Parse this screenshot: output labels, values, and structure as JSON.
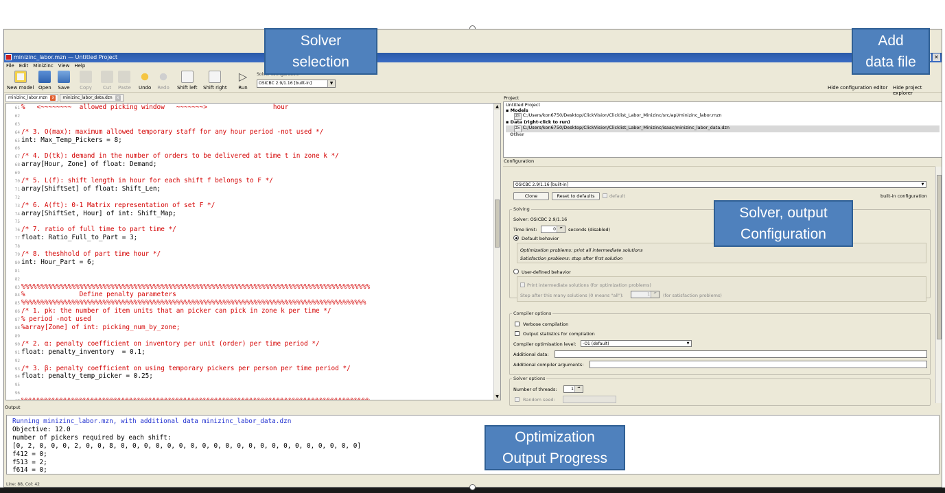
{
  "window": {
    "title": "minizinc_labor.mzn — Untitled Project",
    "controls": [
      "🗗",
      "✕"
    ]
  },
  "menu": [
    "File",
    "Edit",
    "MiniZinc",
    "View",
    "Help"
  ],
  "toolbar": {
    "buttons": [
      {
        "label": "New model",
        "icon": "new-model-icon",
        "enabled": true
      },
      {
        "label": "Open",
        "icon": "folder-open-icon",
        "enabled": true
      },
      {
        "label": "Save",
        "icon": "save-icon",
        "enabled": true
      },
      {
        "label": "Copy",
        "icon": "copy-icon",
        "enabled": false
      },
      {
        "label": "Cut",
        "icon": "scissors-icon",
        "enabled": false
      },
      {
        "label": "Paste",
        "icon": "paste-icon",
        "enabled": false
      },
      {
        "label": "Undo",
        "icon": "undo-icon",
        "enabled": true
      },
      {
        "label": "Redo",
        "icon": "redo-icon",
        "enabled": false
      },
      {
        "label": "Shift left",
        "icon": "shift-left-icon",
        "enabled": true
      },
      {
        "label": "Shift right",
        "icon": "shift-right-icon",
        "enabled": true
      },
      {
        "label": "Run",
        "icon": "play-icon",
        "enabled": true
      }
    ],
    "solver_label": "Solver configuration:",
    "solver_value": "OSICBC 2.9/1.16 [built-in]",
    "right_buttons": [
      {
        "label": "Hide configuration editor",
        "icon": "wrench-icon"
      },
      {
        "label": "Hide project explorer",
        "icon": "project-icon"
      }
    ]
  },
  "tabs": [
    {
      "label": "minizinc_labor.mzn",
      "active": true
    },
    {
      "label": "minizinc_labor_data.dzn",
      "active": false
    }
  ],
  "editor": {
    "lines": [
      {
        "n": "61",
        "text": "%   <~~~~~~~~  allowed picking window   ~~~~~~~>                 hour",
        "kind": "comment"
      },
      {
        "n": "62",
        "text": "",
        "kind": "plain"
      },
      {
        "n": "63",
        "text": "",
        "kind": "plain"
      },
      {
        "n": "64",
        "text": "/* 3. O(max): maximum allowed temporary staff for any hour period -not used */",
        "kind": "comment"
      },
      {
        "n": "65",
        "text": "int: Max_Temp_Pickers = 8;",
        "kind": "code"
      },
      {
        "n": "66",
        "text": "",
        "kind": "plain"
      },
      {
        "n": "67",
        "text": "/* 4. D(tk): demand in the number of orders to be delivered at time t in zone k */",
        "kind": "comment"
      },
      {
        "n": "68",
        "text": "array[Hour, Zone] of float: Demand;",
        "kind": "code"
      },
      {
        "n": "69",
        "text": "",
        "kind": "plain"
      },
      {
        "n": "70",
        "text": "/* 5. L(f): shift length in hour for each shift f belongs to F */",
        "kind": "comment"
      },
      {
        "n": "71",
        "text": "array[ShiftSet] of float: Shift_Len;",
        "kind": "code"
      },
      {
        "n": "72",
        "text": "",
        "kind": "plain"
      },
      {
        "n": "73",
        "text": "/* 6. A(ft): 0-1 Matrix representation of set F */",
        "kind": "comment"
      },
      {
        "n": "74",
        "text": "array[ShiftSet, Hour] of int: Shift_Map;",
        "kind": "code"
      },
      {
        "n": "75",
        "text": "",
        "kind": "plain"
      },
      {
        "n": "76",
        "text": "/* 7. ratio of full time to part time */",
        "kind": "comment"
      },
      {
        "n": "77",
        "text": "float: Ratio_Full_to_Part = 3;",
        "kind": "code"
      },
      {
        "n": "78",
        "text": "",
        "kind": "plain"
      },
      {
        "n": "79",
        "text": "/* 8. theshhold of part time hour */",
        "kind": "comment"
      },
      {
        "n": "80",
        "text": "int: Hour_Part = 6;",
        "kind": "code"
      },
      {
        "n": "81",
        "text": "",
        "kind": "plain"
      },
      {
        "n": "82",
        "text": "",
        "kind": "plain"
      },
      {
        "n": "83",
        "text": "%%%%%%%%%%%%%%%%%%%%%%%%%%%%%%%%%%%%%%%%%%%%%%%%%%%%%%%%%%%%%%%%%%%%%%%%%%%%%%%%%%%%%%%%%%",
        "kind": "comment"
      },
      {
        "n": "84",
        "text": "%              Define penalty parameters",
        "kind": "comment"
      },
      {
        "n": "85",
        "text": "%%%%%%%%%%%%%%%%%%%%%%%%%%%%%%%%%%%%%%%%%%%%%%%%%%%%%%%%%%%%%%%%%%%%%%%%%%%%%%%%%%%%%%%%%",
        "kind": "comment"
      },
      {
        "n": "86",
        "text": "/* 1. pk: the number of item units that an picker can pick in zone k per time */",
        "kind": "comment"
      },
      {
        "n": "87",
        "text": "% period -not used",
        "kind": "comment"
      },
      {
        "n": "88",
        "text": "%array[Zone] of int: picking_num_by_zone;",
        "kind": "comment"
      },
      {
        "n": "89",
        "text": "",
        "kind": "plain"
      },
      {
        "n": "90",
        "text": "/* 2. α: penalty coefficient on inventory per unit (order) per time period */",
        "kind": "comment"
      },
      {
        "n": "91",
        "text": "float: penalty_inventory  = 0.1;",
        "kind": "code"
      },
      {
        "n": "92",
        "text": "",
        "kind": "plain"
      },
      {
        "n": "93",
        "text": "/* 3. β: penalty coefficient on using temporary pickers per person per time period */",
        "kind": "comment"
      },
      {
        "n": "94",
        "text": "float: penalty_temp_picker = 0.25;",
        "kind": "code"
      },
      {
        "n": "95",
        "text": "",
        "kind": "plain"
      },
      {
        "n": "96",
        "text": "",
        "kind": "plain"
      },
      {
        "n": "97",
        "text": "%%%%%%%%%%%%%%%%%%%%%%%%%%%%%%%%%%%%%%%%%%%%%%%%%%%%%%%%%%%%%%%%%%%%%%%%%%%%%%%%%%%%%%%%%%",
        "kind": "comment"
      }
    ]
  },
  "project": {
    "title": "Project",
    "tree": [
      {
        "text": "Untitled Project",
        "kind": "root"
      },
      {
        "text": "Models",
        "kind": "heading"
      },
      {
        "text": "C:/Users/kon6750/Desktop/ClickVision/Clicklist_Labor_Minizinc/src/api/minizinc_labor.mzn",
        "kind": "file"
      },
      {
        "text": "Data (right-click to run)",
        "kind": "heading"
      },
      {
        "text": "C:/Users/kon6750/Desktop/ClickVision/Clicklist_Labor_Minizinc/isaac/minizinc_labor_data.dzn",
        "kind": "file-selected"
      },
      {
        "text": "Other",
        "kind": "other"
      }
    ],
    "file_badge": "Zn"
  },
  "config": {
    "title": "Configuration",
    "solver_value": "OSICBC 2.9/1.16 [built-in]",
    "clone_label": "Clone",
    "reset_label": "Reset to defaults",
    "default_label": "default",
    "builtin_label": "built-in configuration",
    "solving_group": "Solving",
    "solver_text": "Solver:  OSICBC 2.9/1.16",
    "time_limit_label": "Time limit:",
    "time_limit_value": "0",
    "time_limit_suffix": "seconds (disabled)",
    "default_behavior": "Default behavior",
    "opt_text": "Optimization problems: print all intermediate solutions",
    "sat_text": "Satisfaction problems: stop after first solution",
    "user_behavior": "User-defined behavior",
    "print_intermediate": "Print intermediate solutions (for optimization problems)",
    "stop_after_label": "Stop after this many solutions (0 means \"all\"):",
    "stop_after_value": "1",
    "stop_after_suffix": "(for satisfaction problems)",
    "compiler_group": "Compiler options",
    "verbose": "Verbose compilation",
    "output_stats": "Output statistics for compilation",
    "opt_level_label": "Compiler optimisation level:",
    "opt_level_value": "-O1 (default)",
    "additional_data_label": "Additional data:",
    "additional_args_label": "Additional compiler arguments:",
    "solver_options_group": "Solver options",
    "threads_label": "Number of threads:",
    "threads_value": "1",
    "random_seed_label": "Random seed:"
  },
  "output": {
    "title": "Output",
    "lines": [
      {
        "text": "Running minizinc_labor.mzn, with additional data minizinc_labor_data.dzn",
        "kind": "info"
      },
      {
        "text": "Objective: 12.0",
        "kind": "plain"
      },
      {
        "text": "number of pickers required by each shift:",
        "kind": "plain"
      },
      {
        "text": "[0, 2, 0, 0, 0, 2, 0, 0, 8, 0, 0, 0, 0, 0, 0, 0, 0, 0, 0, 0, 0, 0, 0, 0, 0, 0, 0, 0, 0, 0]",
        "kind": "plain"
      },
      {
        "text": "f412 = 0;",
        "kind": "plain"
      },
      {
        "text": "f513 = 2;",
        "kind": "plain"
      },
      {
        "text": "f614 = 0;",
        "kind": "plain"
      }
    ]
  },
  "status": "Line: 88, Col: 42",
  "callouts": {
    "solver_selection": [
      "Solver",
      "selection"
    ],
    "add_data_file": [
      "Add",
      "data file"
    ],
    "solver_output_config": [
      "Solver, output",
      "Configuration"
    ],
    "optimization_output": [
      "Optimization",
      "Output Progress"
    ]
  },
  "colors": {
    "comment": "#d40000",
    "info": "#2030d0",
    "callout": "#4f81bd",
    "titlebar": "#2a5aa8"
  }
}
